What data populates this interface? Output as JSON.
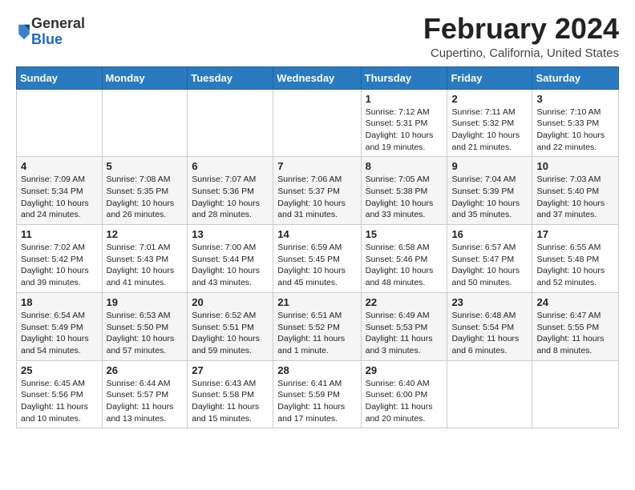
{
  "logo": {
    "general": "General",
    "blue": "Blue"
  },
  "header": {
    "month": "February 2024",
    "location": "Cupertino, California, United States"
  },
  "weekdays": [
    "Sunday",
    "Monday",
    "Tuesday",
    "Wednesday",
    "Thursday",
    "Friday",
    "Saturday"
  ],
  "weeks": [
    [
      {
        "day": "",
        "info": ""
      },
      {
        "day": "",
        "info": ""
      },
      {
        "day": "",
        "info": ""
      },
      {
        "day": "",
        "info": ""
      },
      {
        "day": "1",
        "info": "Sunrise: 7:12 AM\nSunset: 5:31 PM\nDaylight: 10 hours and 19 minutes."
      },
      {
        "day": "2",
        "info": "Sunrise: 7:11 AM\nSunset: 5:32 PM\nDaylight: 10 hours and 21 minutes."
      },
      {
        "day": "3",
        "info": "Sunrise: 7:10 AM\nSunset: 5:33 PM\nDaylight: 10 hours and 22 minutes."
      }
    ],
    [
      {
        "day": "4",
        "info": "Sunrise: 7:09 AM\nSunset: 5:34 PM\nDaylight: 10 hours and 24 minutes."
      },
      {
        "day": "5",
        "info": "Sunrise: 7:08 AM\nSunset: 5:35 PM\nDaylight: 10 hours and 26 minutes."
      },
      {
        "day": "6",
        "info": "Sunrise: 7:07 AM\nSunset: 5:36 PM\nDaylight: 10 hours and 28 minutes."
      },
      {
        "day": "7",
        "info": "Sunrise: 7:06 AM\nSunset: 5:37 PM\nDaylight: 10 hours and 31 minutes."
      },
      {
        "day": "8",
        "info": "Sunrise: 7:05 AM\nSunset: 5:38 PM\nDaylight: 10 hours and 33 minutes."
      },
      {
        "day": "9",
        "info": "Sunrise: 7:04 AM\nSunset: 5:39 PM\nDaylight: 10 hours and 35 minutes."
      },
      {
        "day": "10",
        "info": "Sunrise: 7:03 AM\nSunset: 5:40 PM\nDaylight: 10 hours and 37 minutes."
      }
    ],
    [
      {
        "day": "11",
        "info": "Sunrise: 7:02 AM\nSunset: 5:42 PM\nDaylight: 10 hours and 39 minutes."
      },
      {
        "day": "12",
        "info": "Sunrise: 7:01 AM\nSunset: 5:43 PM\nDaylight: 10 hours and 41 minutes."
      },
      {
        "day": "13",
        "info": "Sunrise: 7:00 AM\nSunset: 5:44 PM\nDaylight: 10 hours and 43 minutes."
      },
      {
        "day": "14",
        "info": "Sunrise: 6:59 AM\nSunset: 5:45 PM\nDaylight: 10 hours and 45 minutes."
      },
      {
        "day": "15",
        "info": "Sunrise: 6:58 AM\nSunset: 5:46 PM\nDaylight: 10 hours and 48 minutes."
      },
      {
        "day": "16",
        "info": "Sunrise: 6:57 AM\nSunset: 5:47 PM\nDaylight: 10 hours and 50 minutes."
      },
      {
        "day": "17",
        "info": "Sunrise: 6:55 AM\nSunset: 5:48 PM\nDaylight: 10 hours and 52 minutes."
      }
    ],
    [
      {
        "day": "18",
        "info": "Sunrise: 6:54 AM\nSunset: 5:49 PM\nDaylight: 10 hours and 54 minutes."
      },
      {
        "day": "19",
        "info": "Sunrise: 6:53 AM\nSunset: 5:50 PM\nDaylight: 10 hours and 57 minutes."
      },
      {
        "day": "20",
        "info": "Sunrise: 6:52 AM\nSunset: 5:51 PM\nDaylight: 10 hours and 59 minutes."
      },
      {
        "day": "21",
        "info": "Sunrise: 6:51 AM\nSunset: 5:52 PM\nDaylight: 11 hours and 1 minute."
      },
      {
        "day": "22",
        "info": "Sunrise: 6:49 AM\nSunset: 5:53 PM\nDaylight: 11 hours and 3 minutes."
      },
      {
        "day": "23",
        "info": "Sunrise: 6:48 AM\nSunset: 5:54 PM\nDaylight: 11 hours and 6 minutes."
      },
      {
        "day": "24",
        "info": "Sunrise: 6:47 AM\nSunset: 5:55 PM\nDaylight: 11 hours and 8 minutes."
      }
    ],
    [
      {
        "day": "25",
        "info": "Sunrise: 6:45 AM\nSunset: 5:56 PM\nDaylight: 11 hours and 10 minutes."
      },
      {
        "day": "26",
        "info": "Sunrise: 6:44 AM\nSunset: 5:57 PM\nDaylight: 11 hours and 13 minutes."
      },
      {
        "day": "27",
        "info": "Sunrise: 6:43 AM\nSunset: 5:58 PM\nDaylight: 11 hours and 15 minutes."
      },
      {
        "day": "28",
        "info": "Sunrise: 6:41 AM\nSunset: 5:59 PM\nDaylight: 11 hours and 17 minutes."
      },
      {
        "day": "29",
        "info": "Sunrise: 6:40 AM\nSunset: 6:00 PM\nDaylight: 11 hours and 20 minutes."
      },
      {
        "day": "",
        "info": ""
      },
      {
        "day": "",
        "info": ""
      }
    ]
  ]
}
